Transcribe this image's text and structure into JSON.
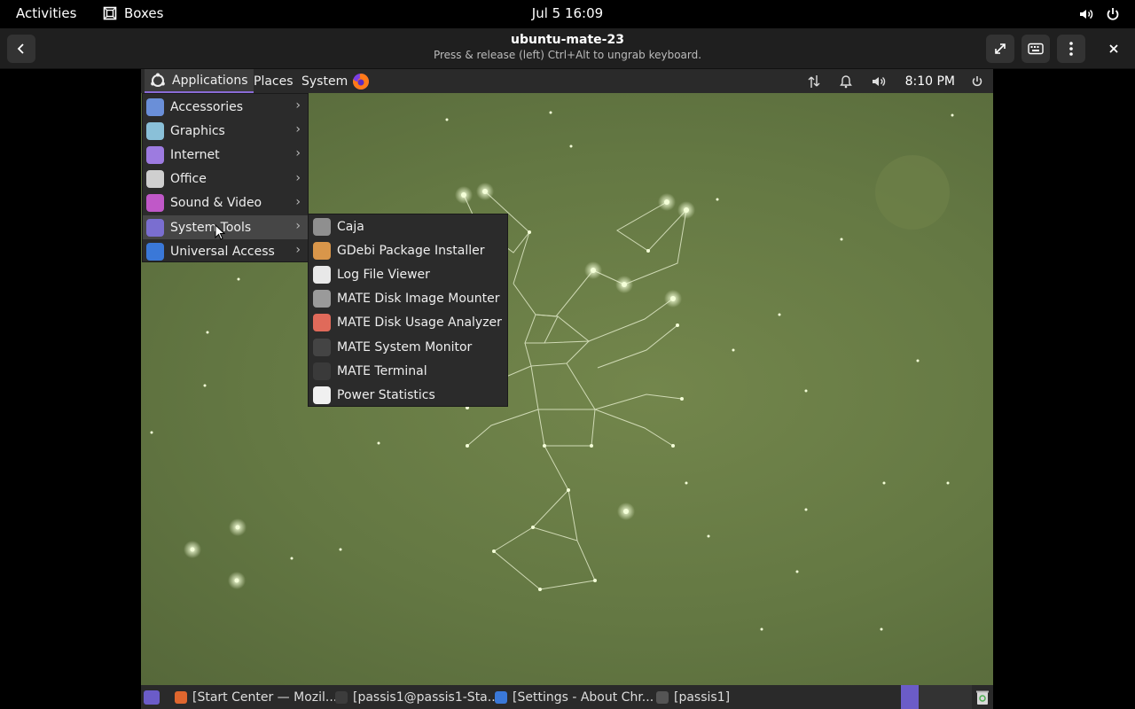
{
  "gnome": {
    "activities": "Activities",
    "app_name": "Boxes",
    "clock": "Jul 5  16:09"
  },
  "boxes": {
    "title": "ubuntu-mate-23",
    "subtitle": "Press & release (left) Ctrl+Alt to ungrab keyboard."
  },
  "mate_panel": {
    "applications": "Applications",
    "places": "Places",
    "system": "System",
    "time": "8:10 PM"
  },
  "apps_menu": {
    "items": [
      {
        "label": "Accessories",
        "color": "#6a8fd8"
      },
      {
        "label": "Graphics",
        "color": "#8ac0d8"
      },
      {
        "label": "Internet",
        "color": "#9d7be0"
      },
      {
        "label": "Office",
        "color": "#cfcfcf"
      },
      {
        "label": "Sound & Video",
        "color": "#c058c8"
      },
      {
        "label": "System Tools",
        "color": "#7a6ed0"
      },
      {
        "label": "Universal Access",
        "color": "#3a78d8"
      }
    ]
  },
  "tools_menu": {
    "items": [
      {
        "label": "Caja",
        "color": "#8f8f8f"
      },
      {
        "label": "GDebi Package Installer",
        "color": "#d9964a"
      },
      {
        "label": "Log File Viewer",
        "color": "#e8e8e8"
      },
      {
        "label": "MATE Disk Image Mounter",
        "color": "#9a9a9a"
      },
      {
        "label": "MATE Disk Usage Analyzer",
        "color": "#e06a5a"
      },
      {
        "label": "MATE System Monitor",
        "color": "#444444"
      },
      {
        "label": "MATE Terminal",
        "color": "#3a3a3a"
      },
      {
        "label": "Power Statistics",
        "color": "#f0f0f0"
      }
    ]
  },
  "taskbar": {
    "tasks": [
      {
        "label": "[Start Center — Mozil...",
        "color": "#e0662e"
      },
      {
        "label": "[passis1@passis1-Sta...",
        "color": "#3c3c3c"
      },
      {
        "label": "[Settings - About Chr...",
        "color": "#3a78d8"
      },
      {
        "label": "[passis1]",
        "color": "#555555"
      }
    ]
  }
}
